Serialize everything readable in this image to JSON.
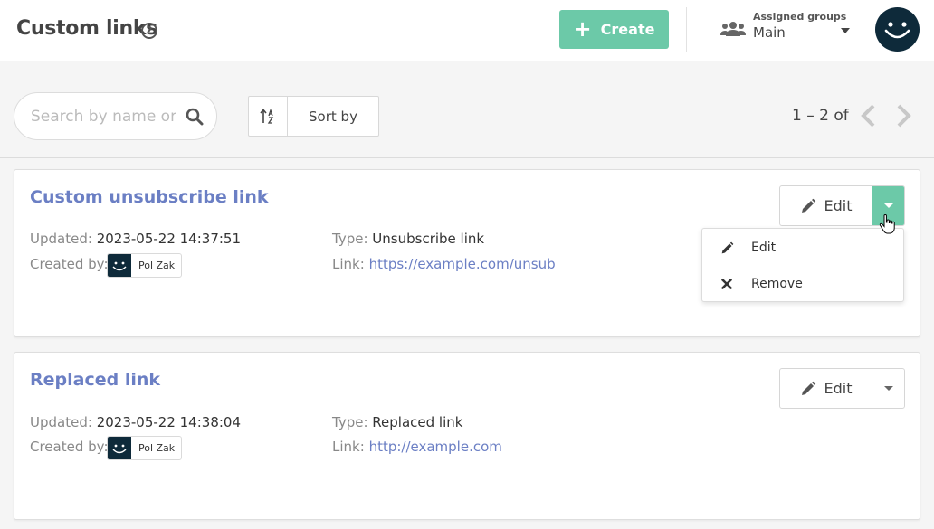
{
  "header": {
    "title": "Custom links",
    "help_symbol": "?",
    "create_label": "Create",
    "groups_label": "Assigned groups",
    "groups_value": "Main"
  },
  "toolbar": {
    "search_placeholder": "Search by name or",
    "sort_label": "Sort by",
    "pager_text": "1 – 2 of"
  },
  "cards": [
    {
      "title": "Custom unsubscribe link",
      "updated_label": "Updated:",
      "updated_value": "2023-05-22 14:37:51",
      "created_label": "Created by:",
      "creator": "Pol Zak",
      "type_label": "Type:",
      "type_value": "Unsubscribe link",
      "link_label": "Link:",
      "link_value": "https://example.com/unsub",
      "edit_label": "Edit",
      "menu_open": true
    },
    {
      "title": "Replaced link",
      "updated_label": "Updated:",
      "updated_value": "2023-05-22 14:38:04",
      "created_label": "Created by:",
      "creator": "Pol Zak",
      "type_label": "Type:",
      "type_value": "Replaced link",
      "link_label": "Link:",
      "link_value": "http://example.com",
      "edit_label": "Edit",
      "menu_open": false
    }
  ],
  "dropdown": {
    "items": [
      {
        "label": "Edit",
        "icon": "pencil-icon"
      },
      {
        "label": "Remove",
        "icon": "close-icon"
      }
    ]
  },
  "colors": {
    "accent": "#6cc9a8",
    "link": "#6b7fc4",
    "avatar": "#0e2a3a"
  }
}
